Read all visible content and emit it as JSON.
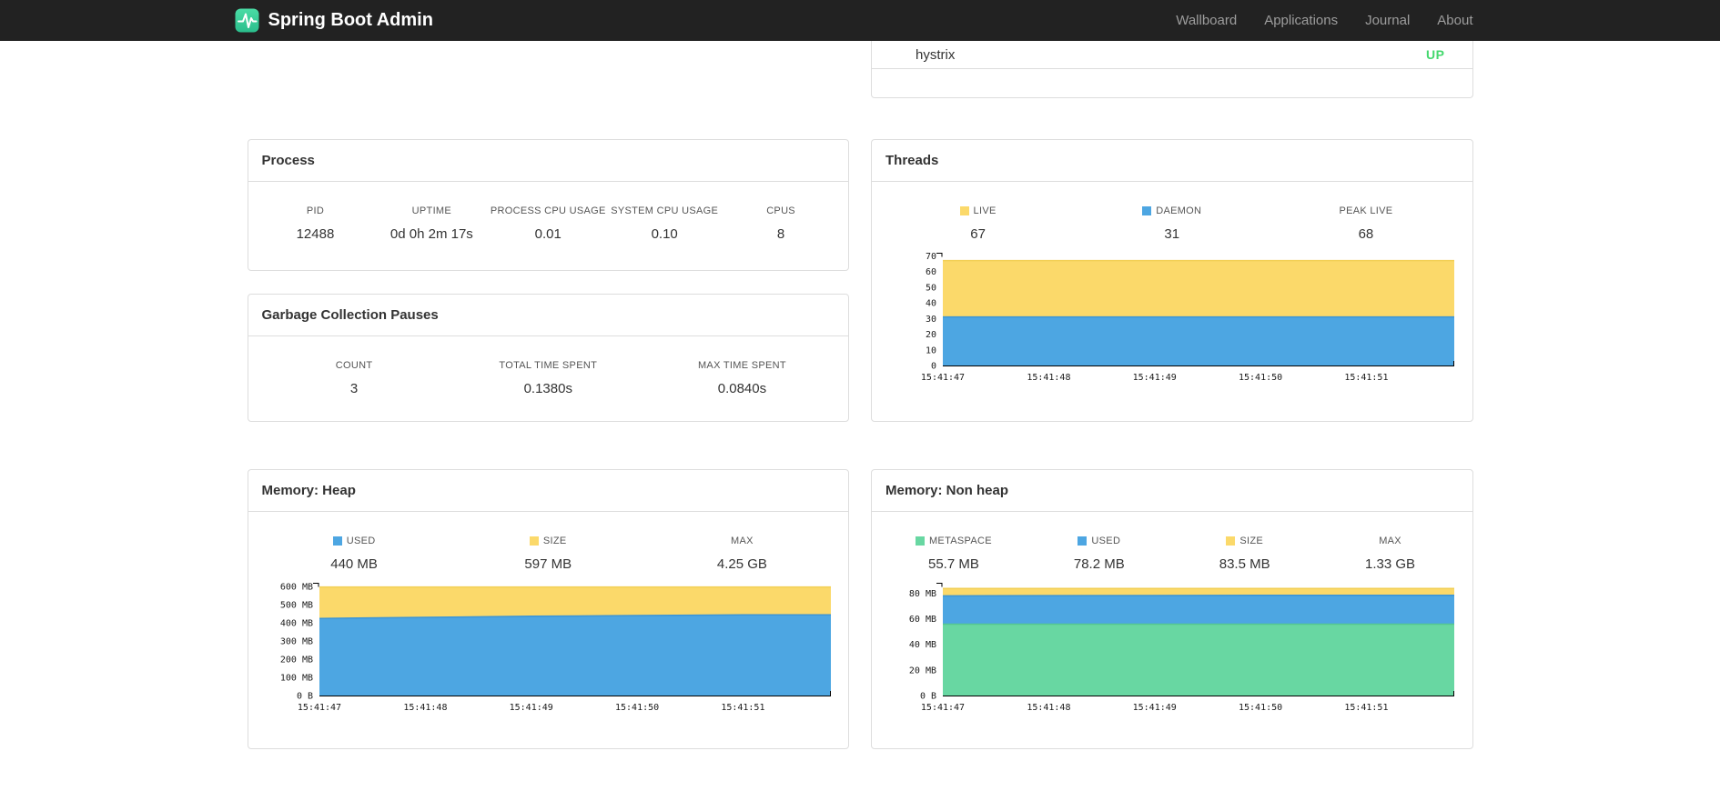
{
  "navbar": {
    "brand": "Spring Boot Admin",
    "links": [
      {
        "label": "Wallboard"
      },
      {
        "label": "Applications"
      },
      {
        "label": "Journal"
      },
      {
        "label": "About"
      }
    ]
  },
  "application_row": {
    "name": "hystrix",
    "status": "UP"
  },
  "colors": {
    "status_up": "#44d86e",
    "logo_green_light": "#4adca5",
    "logo_green_dark": "#2bbe8c",
    "series_yellow": "#fbd96a",
    "series_blue": "#4da6e2",
    "series_green": "#68d7a2",
    "navbar_bg": "#222222",
    "card_border": "#dddddd"
  },
  "cards": {
    "process": {
      "title": "Process",
      "stats": [
        {
          "label": "PID",
          "value": "12488"
        },
        {
          "label": "UPTIME",
          "value": "0d 0h 2m 17s"
        },
        {
          "label": "PROCESS CPU USAGE",
          "value": "0.01"
        },
        {
          "label": "SYSTEM CPU USAGE",
          "value": "0.10"
        },
        {
          "label": "CPUS",
          "value": "8"
        }
      ]
    },
    "gc": {
      "title": "Garbage Collection Pauses",
      "stats": [
        {
          "label": "COUNT",
          "value": "3"
        },
        {
          "label": "TOTAL TIME SPENT",
          "value": "0.1380s"
        },
        {
          "label": "MAX TIME SPENT",
          "value": "0.0840s"
        }
      ]
    },
    "threads": {
      "title": "Threads",
      "stats": [
        {
          "label": "LIVE",
          "value": "67",
          "swatch": "#fbd96a"
        },
        {
          "label": "DAEMON",
          "value": "31",
          "swatch": "#4da6e2"
        },
        {
          "label": "PEAK LIVE",
          "value": "68"
        }
      ]
    },
    "heap": {
      "title": "Memory: Heap",
      "stats": [
        {
          "label": "USED",
          "value": "440 MB",
          "swatch": "#4da6e2"
        },
        {
          "label": "SIZE",
          "value": "597 MB",
          "swatch": "#fbd96a"
        },
        {
          "label": "MAX",
          "value": "4.25 GB"
        }
      ]
    },
    "nonheap": {
      "title": "Memory: Non heap",
      "stats": [
        {
          "label": "METASPACE",
          "value": "55.7 MB",
          "swatch": "#68d7a2"
        },
        {
          "label": "USED",
          "value": "78.2 MB",
          "swatch": "#4da6e2"
        },
        {
          "label": "SIZE",
          "value": "83.5 MB",
          "swatch": "#fbd96a"
        },
        {
          "label": "MAX",
          "value": "1.33 GB"
        }
      ]
    }
  },
  "chart_data": [
    {
      "id": "threads",
      "type": "area",
      "title": "Threads",
      "x": [
        "15:41:47",
        "15:41:48",
        "15:41:49",
        "15:41:50",
        "15:41:51"
      ],
      "series": [
        {
          "name": "LIVE",
          "fill": "#fbd96a",
          "stroke": "#f2cf55",
          "values": [
            67,
            67,
            67,
            67,
            67
          ]
        },
        {
          "name": "DAEMON",
          "fill": "#4da6e2",
          "stroke": "#3b94d6",
          "values": [
            31,
            31,
            31,
            31,
            31
          ]
        }
      ],
      "ylim": [
        0,
        72
      ],
      "yticks": [
        0,
        10,
        20,
        30,
        40,
        50,
        60,
        70
      ],
      "ytick_labels": [
        "0",
        "10",
        "20",
        "30",
        "40",
        "50",
        "60",
        "70"
      ],
      "xlabel": "",
      "ylabel": "",
      "grid": false,
      "legend_position": "top"
    },
    {
      "id": "heap",
      "type": "area",
      "title": "Memory: Heap",
      "x": [
        "15:41:47",
        "15:41:48",
        "15:41:49",
        "15:41:50",
        "15:41:51"
      ],
      "series": [
        {
          "name": "SIZE",
          "fill": "#fbd96a",
          "stroke": "#f2cf55",
          "values": [
            597,
            597,
            597,
            597,
            597
          ]
        },
        {
          "name": "USED",
          "fill": "#4da6e2",
          "stroke": "#3b94d6",
          "values": [
            424,
            430,
            436,
            440,
            444
          ]
        }
      ],
      "ylim": [
        0,
        620
      ],
      "yticks": [
        0,
        100,
        200,
        300,
        400,
        500,
        600
      ],
      "ytick_labels": [
        "0 B",
        "100 MB",
        "200 MB",
        "300 MB",
        "400 MB",
        "500 MB",
        "600 MB"
      ],
      "xlabel": "",
      "ylabel": "",
      "grid": false,
      "legend_position": "top"
    },
    {
      "id": "nonheap",
      "type": "area",
      "title": "Memory: Non heap",
      "x": [
        "15:41:47",
        "15:41:48",
        "15:41:49",
        "15:41:50",
        "15:41:51"
      ],
      "series": [
        {
          "name": "SIZE",
          "fill": "#fbd96a",
          "stroke": "#f2cf55",
          "values": [
            83.5,
            83.5,
            83.5,
            83.5,
            83.5
          ]
        },
        {
          "name": "USED",
          "fill": "#4da6e2",
          "stroke": "#3b94d6",
          "values": [
            77.8,
            78.0,
            78.1,
            78.2,
            78.2
          ]
        },
        {
          "name": "METASPACE",
          "fill": "#68d7a2",
          "stroke": "#55c78f",
          "values": [
            55.7,
            55.7,
            55.7,
            55.7,
            55.7
          ]
        }
      ],
      "ylim": [
        0,
        88
      ],
      "yticks": [
        0,
        20,
        40,
        60,
        80
      ],
      "ytick_labels": [
        "0 B",
        "20 MB",
        "40 MB",
        "60 MB",
        "80 MB"
      ],
      "xlabel": "",
      "ylabel": "",
      "grid": false,
      "legend_position": "top"
    }
  ]
}
